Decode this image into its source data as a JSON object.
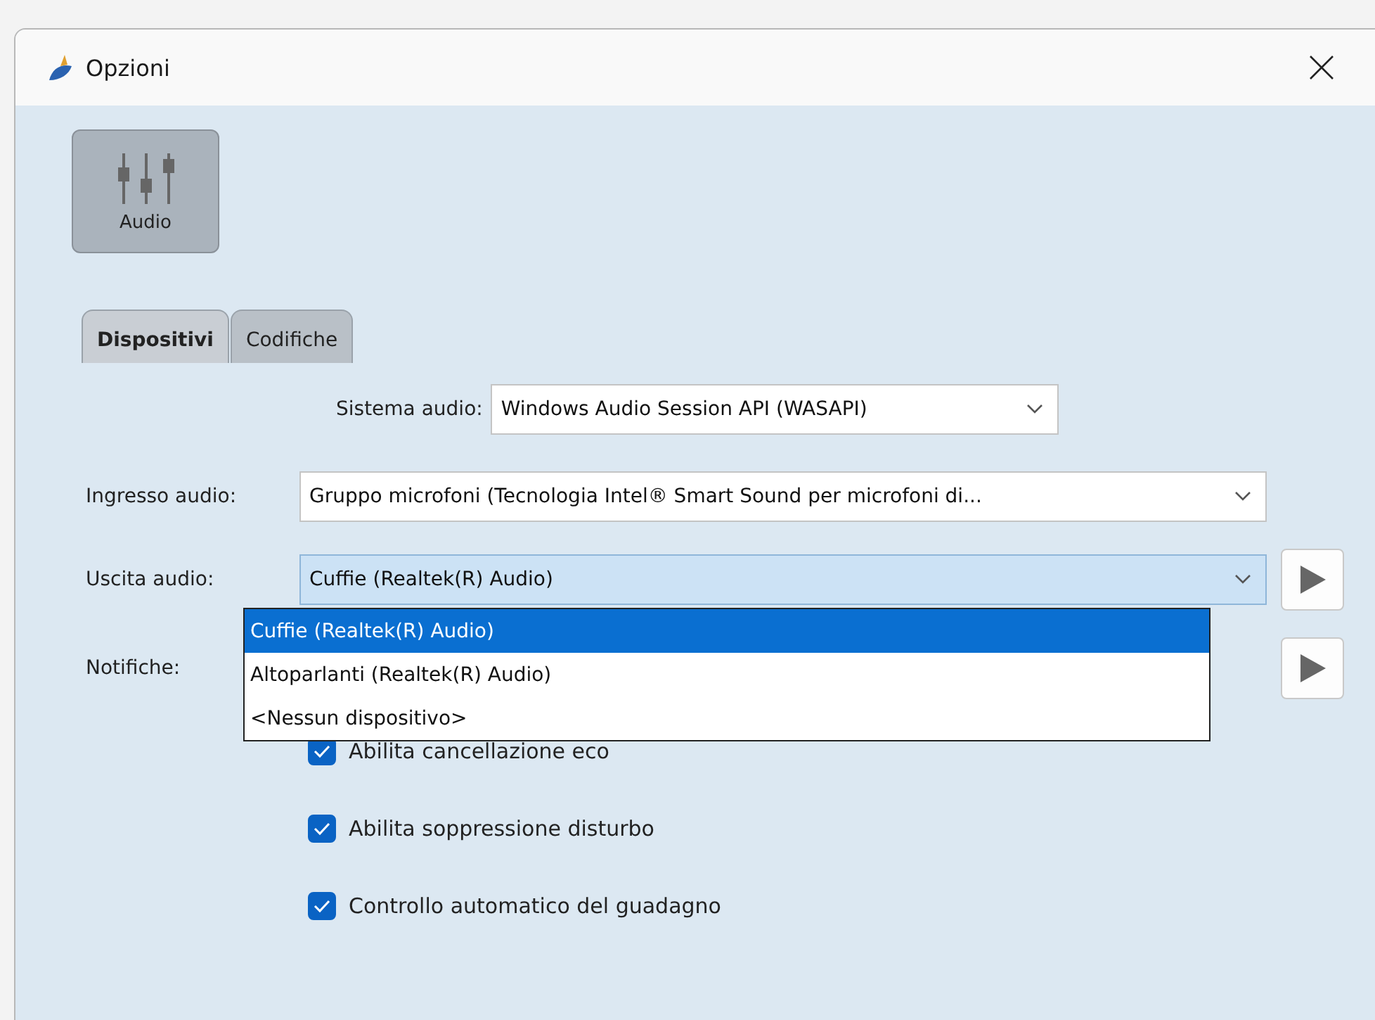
{
  "window": {
    "title": "Opzioni"
  },
  "sections": [
    {
      "label": "Audio",
      "selected": true
    }
  ],
  "tabs": [
    {
      "label": "Dispositivi",
      "selected": true
    },
    {
      "label": "Codifiche",
      "selected": false
    }
  ],
  "system": {
    "label": "Sistema audio:",
    "value": "Windows Audio Session API (WASAPI)"
  },
  "input": {
    "label": "Ingresso audio:",
    "value": "Gruppo microfoni (Tecnologia Intel® Smart Sound per microfoni di..."
  },
  "output": {
    "label": "Uscita audio:",
    "value": "Cuffie (Realtek(R) Audio)",
    "expanded": true,
    "options": [
      {
        "label": "Cuffie (Realtek(R) Audio)",
        "selected": true
      },
      {
        "label": "Altoparlanti (Realtek(R) Audio)",
        "selected": false
      },
      {
        "label": "<Nessun dispositivo>",
        "selected": false
      }
    ]
  },
  "notifications": {
    "label": "Notifiche:"
  },
  "checkboxes": [
    {
      "label": "Abilita cancellazione eco",
      "checked": true
    },
    {
      "label": "Abilita soppressione disturbo",
      "checked": true
    },
    {
      "label": "Controllo automatico del guadagno",
      "checked": true
    }
  ]
}
